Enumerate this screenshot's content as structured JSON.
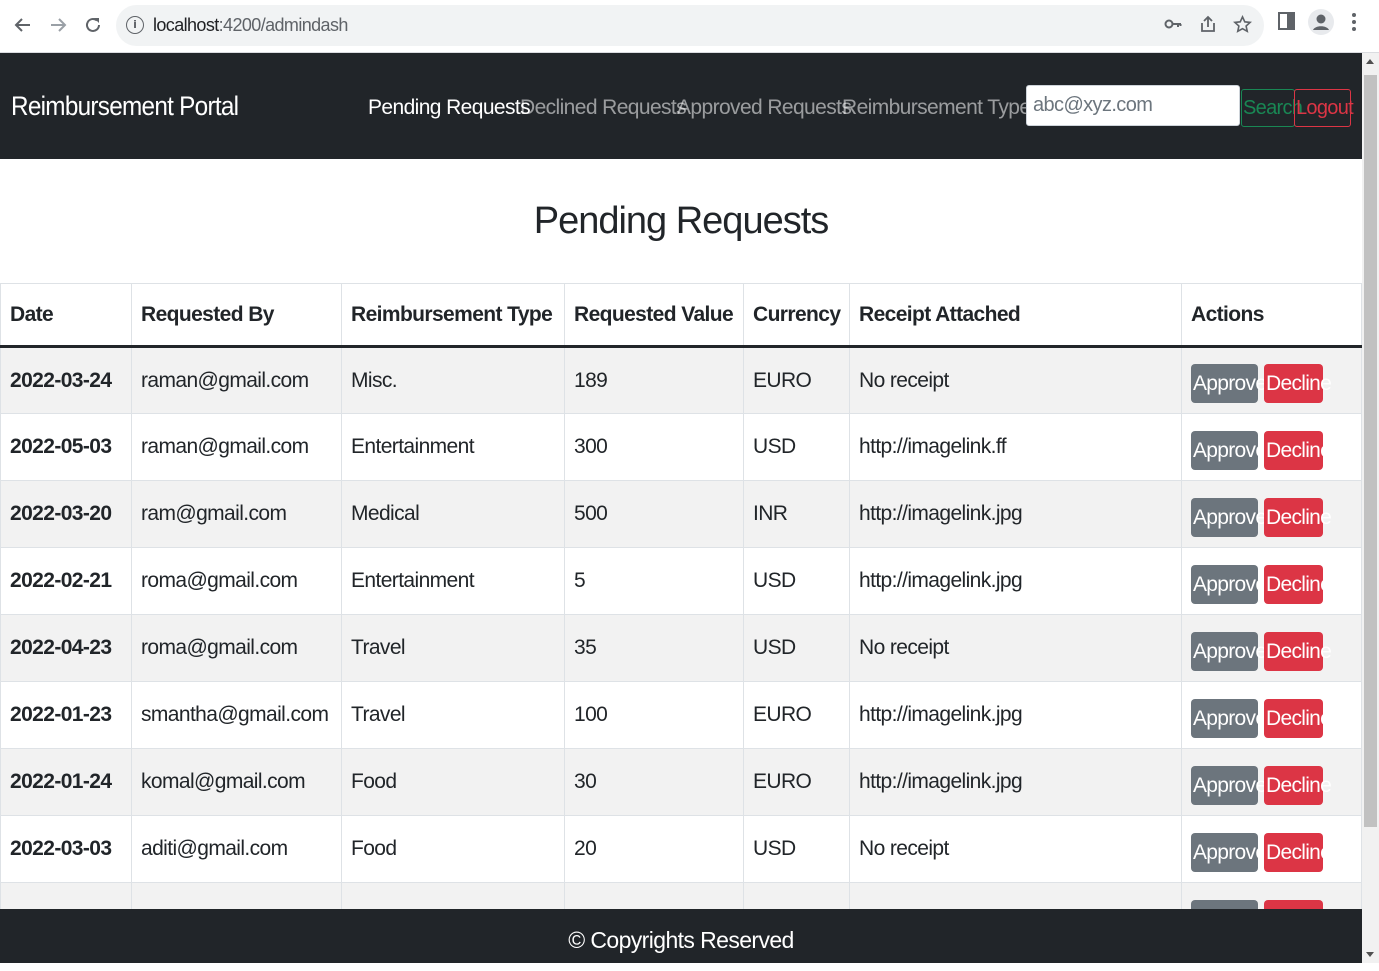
{
  "browser": {
    "url_host": "localhost",
    "url_path": ":4200/admindash"
  },
  "navbar": {
    "brand": "Reimbursement Portal",
    "links": [
      {
        "label": "Pending Requests"
      },
      {
        "label": "Declined Requests"
      },
      {
        "label": "Approved Requests"
      },
      {
        "label": "Reimbursement Type"
      }
    ],
    "search_placeholder": "abc@xyz.com",
    "search_label": "Search",
    "logout_label": "Logout"
  },
  "page": {
    "title": "Pending Requests"
  },
  "table": {
    "headers": [
      "Date",
      "Requested By",
      "Reimbursement Type",
      "Requested Value",
      "Currency",
      "Receipt Attached",
      "Actions"
    ],
    "rows": [
      {
        "date": "2022-03-24",
        "by": "raman@gmail.com",
        "type": "Misc.",
        "value": "189",
        "currency": "EURO",
        "receipt": "No receipt"
      },
      {
        "date": "2022-05-03",
        "by": "raman@gmail.com",
        "type": "Entertainment",
        "value": "300",
        "currency": "USD",
        "receipt": "http://imagelink.ff"
      },
      {
        "date": "2022-03-20",
        "by": "ram@gmail.com",
        "type": "Medical",
        "value": "500",
        "currency": "INR",
        "receipt": "http://imagelink.jpg"
      },
      {
        "date": "2022-02-21",
        "by": "roma@gmail.com",
        "type": "Entertainment",
        "value": "5",
        "currency": "USD",
        "receipt": "http://imagelink.jpg"
      },
      {
        "date": "2022-04-23",
        "by": "roma@gmail.com",
        "type": "Travel",
        "value": "35",
        "currency": "USD",
        "receipt": "No receipt"
      },
      {
        "date": "2022-01-23",
        "by": "smantha@gmail.com",
        "type": "Travel",
        "value": "100",
        "currency": "EURO",
        "receipt": "http://imagelink.jpg"
      },
      {
        "date": "2022-01-24",
        "by": "komal@gmail.com",
        "type": "Food",
        "value": "30",
        "currency": "EURO",
        "receipt": "http://imagelink.jpg"
      },
      {
        "date": "2022-03-03",
        "by": "aditi@gmail.com",
        "type": "Food",
        "value": "20",
        "currency": "USD",
        "receipt": "No receipt"
      }
    ],
    "approve_label": "Approve",
    "decline_label": "Decline"
  },
  "footer": {
    "text": "© Copyrights Reserved"
  },
  "colors": {
    "navbar_bg": "#212529",
    "approve": "#6c757d",
    "decline": "#dc3545",
    "search": "#198754"
  }
}
